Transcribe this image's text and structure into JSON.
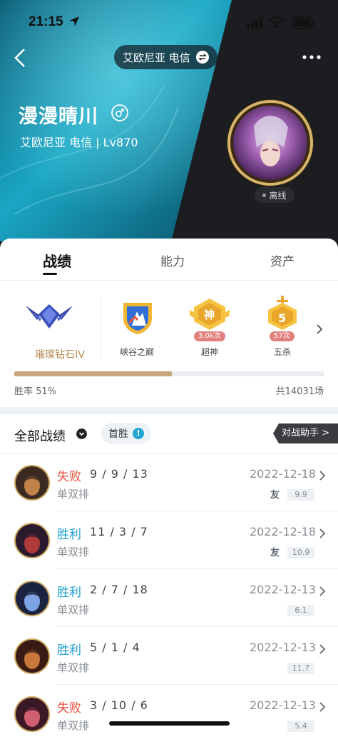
{
  "status_bar": {
    "time": "21:15"
  },
  "header": {
    "server_switch_label": "艾欧尼亚 电信",
    "player_name": "漫漫晴川",
    "subtitle": "艾欧尼亚 电信 | Lv870",
    "status": "离线"
  },
  "tabs": [
    {
      "label": "战绩",
      "active": true
    },
    {
      "label": "能力",
      "active": false
    },
    {
      "label": "资产",
      "active": false
    }
  ],
  "honors": {
    "rank": "璀璨钻石IV",
    "items": [
      {
        "label": "峡谷之巅",
        "badge": "",
        "glyph": ""
      },
      {
        "label": "超神",
        "badge": "3.0k次",
        "glyph": "神"
      },
      {
        "label": "五杀",
        "badge": "57次",
        "glyph": "5"
      }
    ]
  },
  "winrate": {
    "label": "胜率 51%",
    "value": 0.51,
    "total": "共14031场"
  },
  "filter": {
    "title": "全部战绩",
    "first_win": "首胜",
    "assist": "对战助手 >"
  },
  "matches": [
    {
      "result": "失败",
      "kda": "9 / 9 / 13",
      "mode": "单双排",
      "date": "2022-12-18",
      "friend": "友",
      "score": "9.9"
    },
    {
      "result": "胜利",
      "kda": "11 / 3 / 7",
      "mode": "单双排",
      "date": "2022-12-18",
      "friend": "友",
      "score": "10.9"
    },
    {
      "result": "胜利",
      "kda": "2 / 7 / 18",
      "mode": "单双排",
      "date": "2022-12-13",
      "friend": "",
      "score": "6.1"
    },
    {
      "result": "胜利",
      "kda": "5 / 1 / 4",
      "mode": "单双排",
      "date": "2022-12-13",
      "friend": "",
      "score": "11.7"
    },
    {
      "result": "失败",
      "kda": "3 / 10 / 6",
      "mode": "单双排",
      "date": "2022-12-13",
      "friend": "",
      "score": "5.4"
    }
  ],
  "colors": {
    "win": "#1f9fd0",
    "loss": "#e8533f",
    "rank_gold": "#b68a56",
    "teal": "#1aa6c4",
    "dark": "#1b1d20"
  }
}
